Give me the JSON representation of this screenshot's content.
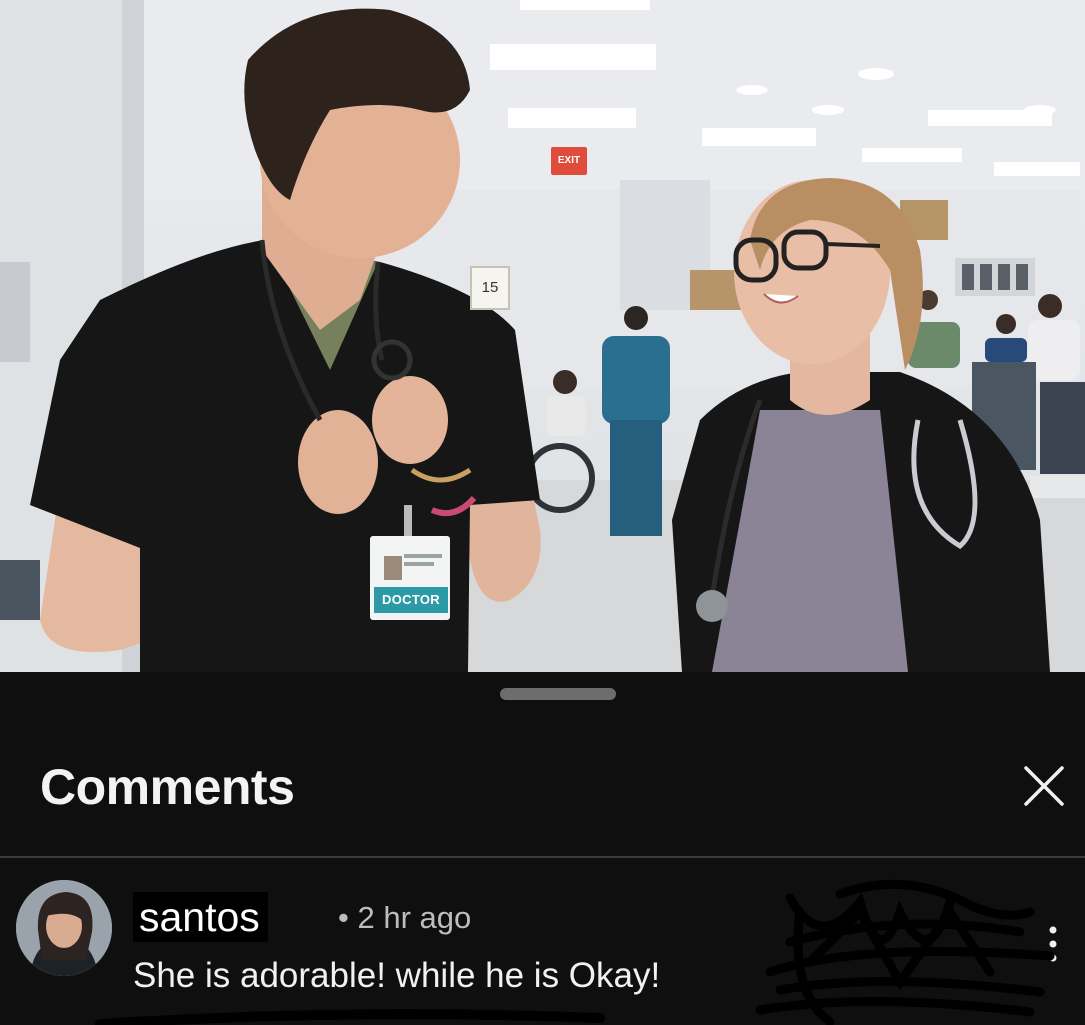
{
  "photo": {
    "badge_label": "DOCTOR",
    "exit_sign": "EXIT",
    "room_number": "15"
  },
  "sheet": {
    "title": "Comments",
    "close_icon": "close-icon"
  },
  "comment": {
    "author": "santos",
    "separator": "•",
    "time": "2 hr ago",
    "text": "She is adorable! while he is Okay!",
    "more_icon": "more-vertical-icon"
  },
  "colors": {
    "background": "#0f0f0f",
    "title": "#f3f3f3",
    "meta": "#bdbdbd",
    "divider": "#3b3b3b",
    "badge": "#2b9aa6"
  }
}
